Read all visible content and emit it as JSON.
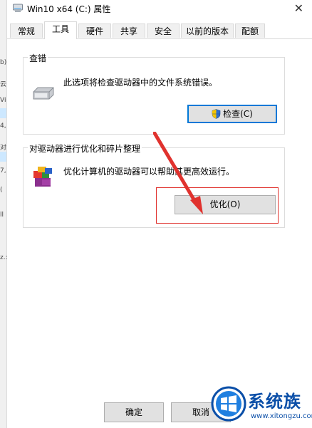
{
  "window": {
    "title": "Win10 x64 (C:) 属性",
    "close_glyph": "✕"
  },
  "tabs": [
    {
      "label": "常规"
    },
    {
      "label": "工具"
    },
    {
      "label": "硬件"
    },
    {
      "label": "共享"
    },
    {
      "label": "安全"
    },
    {
      "label": "以前的版本"
    },
    {
      "label": "配额"
    }
  ],
  "active_tab": "工具",
  "error_check": {
    "title": "查错",
    "description": "此选项将检查驱动器中的文件系统错误。",
    "button_label": "检查(C)"
  },
  "optimize": {
    "title": "对驱动器进行优化和碎片整理",
    "description": "优化计算机的驱动器可以帮助其更高效运行。",
    "button_label": "优化(O)"
  },
  "footer": {
    "ok_label": "确定",
    "cancel_label": "取消"
  },
  "left_strip": [
    "b)",
    "云",
    "Vi",
    "4,",
    "对",
    "7,",
    "(",
    "ll",
    "z.:"
  ],
  "watermark": {
    "brand": "系统族",
    "url": "www.xitongzu.com"
  },
  "colors": {
    "annotation_red": "#e0322e",
    "accent_blue": "#0078d7"
  }
}
